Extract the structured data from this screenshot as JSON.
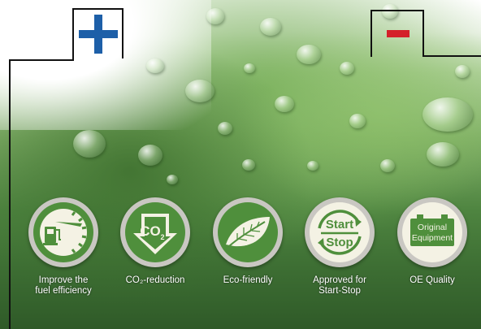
{
  "colors": {
    "plus": "#1d5fa8",
    "minus": "#d4202a",
    "badge_green": "#4f8f3c",
    "badge_cream": "#f4f2e4"
  },
  "terminals": {
    "positive_icon": "plus-icon",
    "negative_icon": "minus-icon"
  },
  "features": [
    {
      "icon": "fuel-gauge-icon",
      "caption": "Improve the\nfuel efficiency"
    },
    {
      "icon": "co2-arrow-icon",
      "label": "CO",
      "sub": "2",
      "caption": "CO₂-reduction"
    },
    {
      "icon": "leaf-icon",
      "caption": "Eco-friendly"
    },
    {
      "icon": "start-stop-icon",
      "label_top": "Start",
      "label_bottom": "Stop",
      "caption": "Approved for\nStart-Stop"
    },
    {
      "icon": "battery-icon",
      "label_top": "Original",
      "label_bottom": "Equipment",
      "caption": "OE Quality"
    }
  ]
}
